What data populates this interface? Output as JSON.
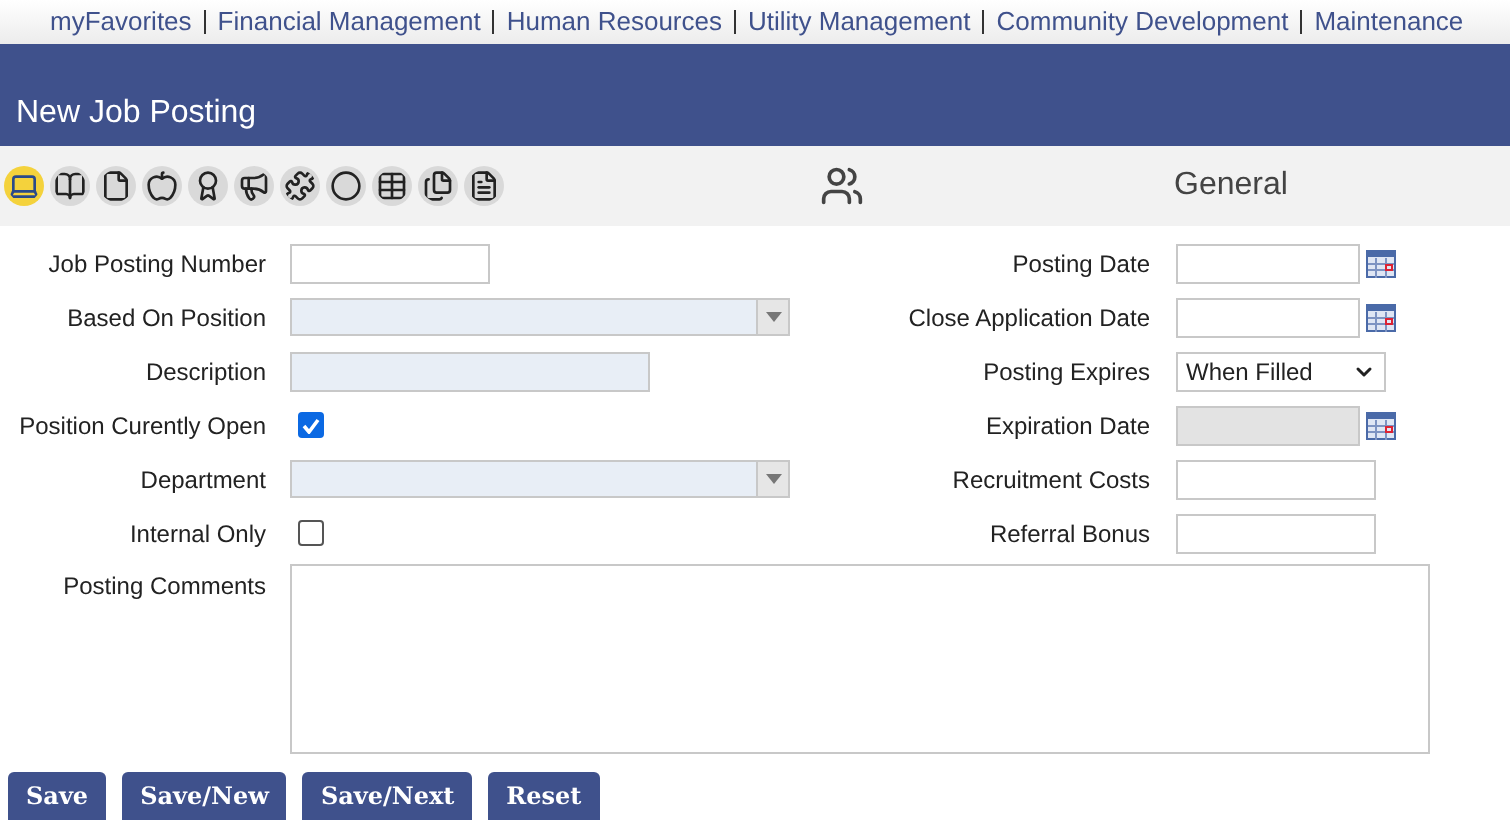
{
  "top_nav": [
    "myFavorites",
    "Financial Management",
    "Human Resources",
    "Utility Management",
    "Community Development",
    "Maintenance"
  ],
  "title": "New Job Posting",
  "section": "General",
  "left_fields": [
    {
      "label": "Job Posting Number",
      "kind": "text"
    },
    {
      "label": "Based On Position",
      "kind": "select"
    },
    {
      "label": "Description",
      "kind": "readonly"
    },
    {
      "label": "Position Curently Open",
      "kind": "checkbox",
      "checked": true
    },
    {
      "label": "Department",
      "kind": "select"
    },
    {
      "label": "Internal Only",
      "kind": "checkbox",
      "checked": false
    }
  ],
  "right_fields": [
    {
      "label": "Posting Date",
      "kind": "date",
      "disabled": false
    },
    {
      "label": "Close Application Date",
      "kind": "date",
      "disabled": false
    },
    {
      "label": "Posting Expires",
      "kind": "dropdown",
      "value": "When Filled"
    },
    {
      "label": "Expiration Date",
      "kind": "date",
      "disabled": true
    },
    {
      "label": "Recruitment Costs",
      "kind": "text"
    },
    {
      "label": "Referral Bonus",
      "kind": "text"
    }
  ],
  "comments_label": "Posting Comments",
  "buttons": [
    "Save",
    "Save/New",
    "Save/Next",
    "Reset"
  ]
}
